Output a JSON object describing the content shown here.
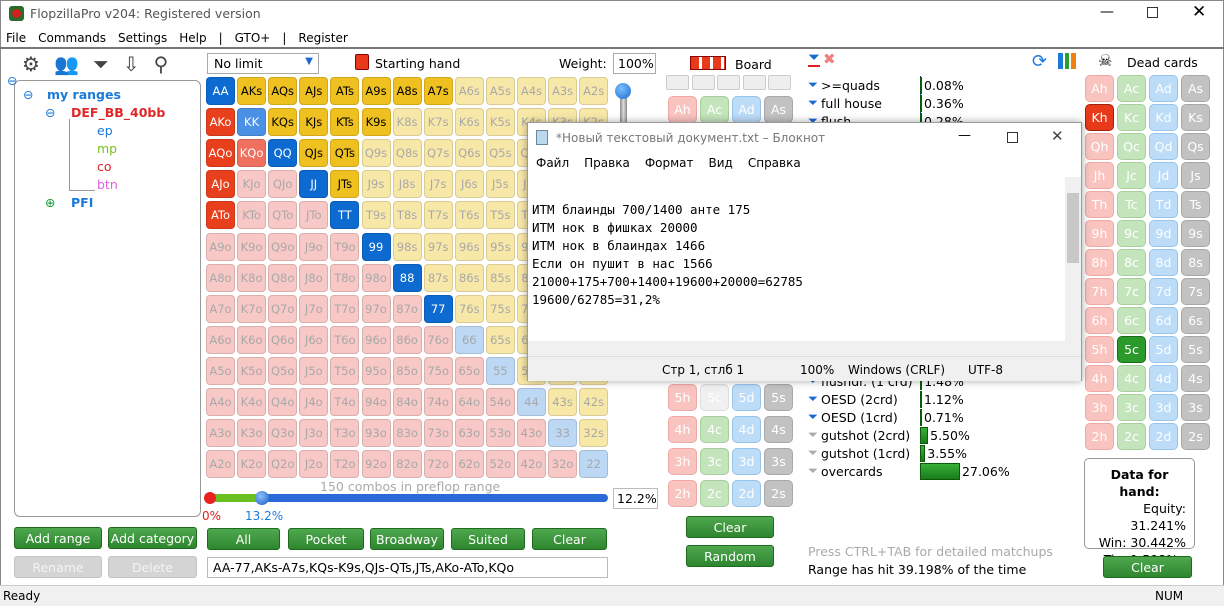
{
  "window": {
    "title": "FlopzillaPro v204: Registered version",
    "menu": [
      "File",
      "Commands",
      "Settings",
      "Help",
      "|",
      "GTO+",
      "|",
      "Register"
    ]
  },
  "tree": {
    "root": "my ranges",
    "group": "DEF_BB_40bb",
    "children": [
      {
        "label": "ep",
        "color": "#1a7ad8"
      },
      {
        "label": "mp",
        "color": "#7ac020"
      },
      {
        "label": "co",
        "color": "#e02020"
      },
      {
        "label": "btn",
        "color": "#e060e0"
      }
    ],
    "other": "PFI"
  },
  "left_buttons": {
    "add_range": "Add range",
    "add_category": "Add category",
    "rename": "Rename",
    "delete": "Delete"
  },
  "hand": {
    "game": "No limit",
    "title": "Starting hand",
    "weight_label": "Weight:",
    "weight": "100%",
    "ranks": [
      "A",
      "K",
      "Q",
      "J",
      "T",
      "9",
      "8",
      "7",
      "6",
      "5",
      "4",
      "3",
      "2"
    ],
    "states": [
      "SSSSSSSS.....",
      "SPSSSS.......",
      "SPSSS........",
      "S..SS........",
      "S...S........",
      ".....S.......",
      "......S......",
      ".......S.....",
      ".............",
      ".............",
      ".............",
      ".............",
      "............."
    ],
    "combos": "150 combos in preflop range",
    "slider_min": "0%",
    "slider_val": "13.2%",
    "pct": "12.2%",
    "buttons": [
      "All",
      "Pocket",
      "Broadway",
      "Suited",
      "Clear"
    ],
    "range_text": "AA-77,AKs-A7s,KQs-K9s,QJs-QTs,JTs,AKo-ATo,KQo"
  },
  "colors": {
    "pair_sel": "#0c6ad0",
    "pair_part": "#4a90e4",
    "pair_off": "#bcd8f4",
    "suited_sel": "#eec020",
    "suited_off": "#f8e8a8",
    "off_sel": "#e8401c",
    "off_part": "#f07060",
    "off_off": "#f8c8c6"
  },
  "board": {
    "title": "Board",
    "suits": [
      "h",
      "c",
      "d",
      "s"
    ],
    "disabled": [
      "5c"
    ],
    "clear": "Clear",
    "random": "Random"
  },
  "stats": {
    "rows": [
      {
        "name": ">=quads",
        "pct": "0.08%",
        "v": 0.08,
        "icon": "blue"
      },
      {
        "name": "full house",
        "pct": "0.36%",
        "v": 0.36,
        "icon": "blue"
      },
      {
        "name": "flush",
        "pct": "0.28%",
        "v": 0.28,
        "icon": "blue"
      },
      {
        "name": "flushdr. (1 crd)",
        "pct": "1.48%",
        "v": 1.48,
        "icon": "blue"
      },
      {
        "name": "OESD (2crd)",
        "pct": "1.12%",
        "v": 1.12,
        "icon": "blue"
      },
      {
        "name": "OESD (1crd)",
        "pct": "0.71%",
        "v": 0.71,
        "icon": "blue"
      },
      {
        "name": "gutshot (2crd)",
        "pct": "5.50%",
        "v": 5.5,
        "icon": "grey"
      },
      {
        "name": "gutshot (1crd)",
        "pct": "3.55%",
        "v": 3.55,
        "icon": "grey"
      },
      {
        "name": "overcards",
        "pct": "27.06%",
        "v": 27.06,
        "icon": "grey"
      }
    ],
    "hint": "Press CTRL+TAB for detailed matchups",
    "hit": "Range has hit 39.198% of the time"
  },
  "dead": {
    "title": "Dead cards",
    "selected": [
      "Kh",
      "5c"
    ],
    "clear": "Clear"
  },
  "hand_data": {
    "title": "Data for hand:",
    "equity": "Equity: 31.241%",
    "win": "Win: 30.442%",
    "tie": "Tie: 1.598%"
  },
  "notepad": {
    "title": "*Новый текстовый документ.txt – Блокнот",
    "menu": [
      "Файл",
      "Правка",
      "Формат",
      "Вид",
      "Справка"
    ],
    "lines": [
      "",
      "ИТМ блаинды 700/1400 анте 175",
      "ИТМ нок в фишках 20000",
      "ИТМ нок в блаиндах 1466",
      "Если он пушит в нас 1566",
      "21000+175+700+1400+19600+20000=62785",
      "19600/62785=31,2%"
    ],
    "status": {
      "pos": "Стр 1, стлб 1",
      "zoom": "100%",
      "eol": "Windows (CRLF)",
      "enc": "UTF-8"
    }
  },
  "status": {
    "left": "Ready",
    "num": "NUM"
  }
}
